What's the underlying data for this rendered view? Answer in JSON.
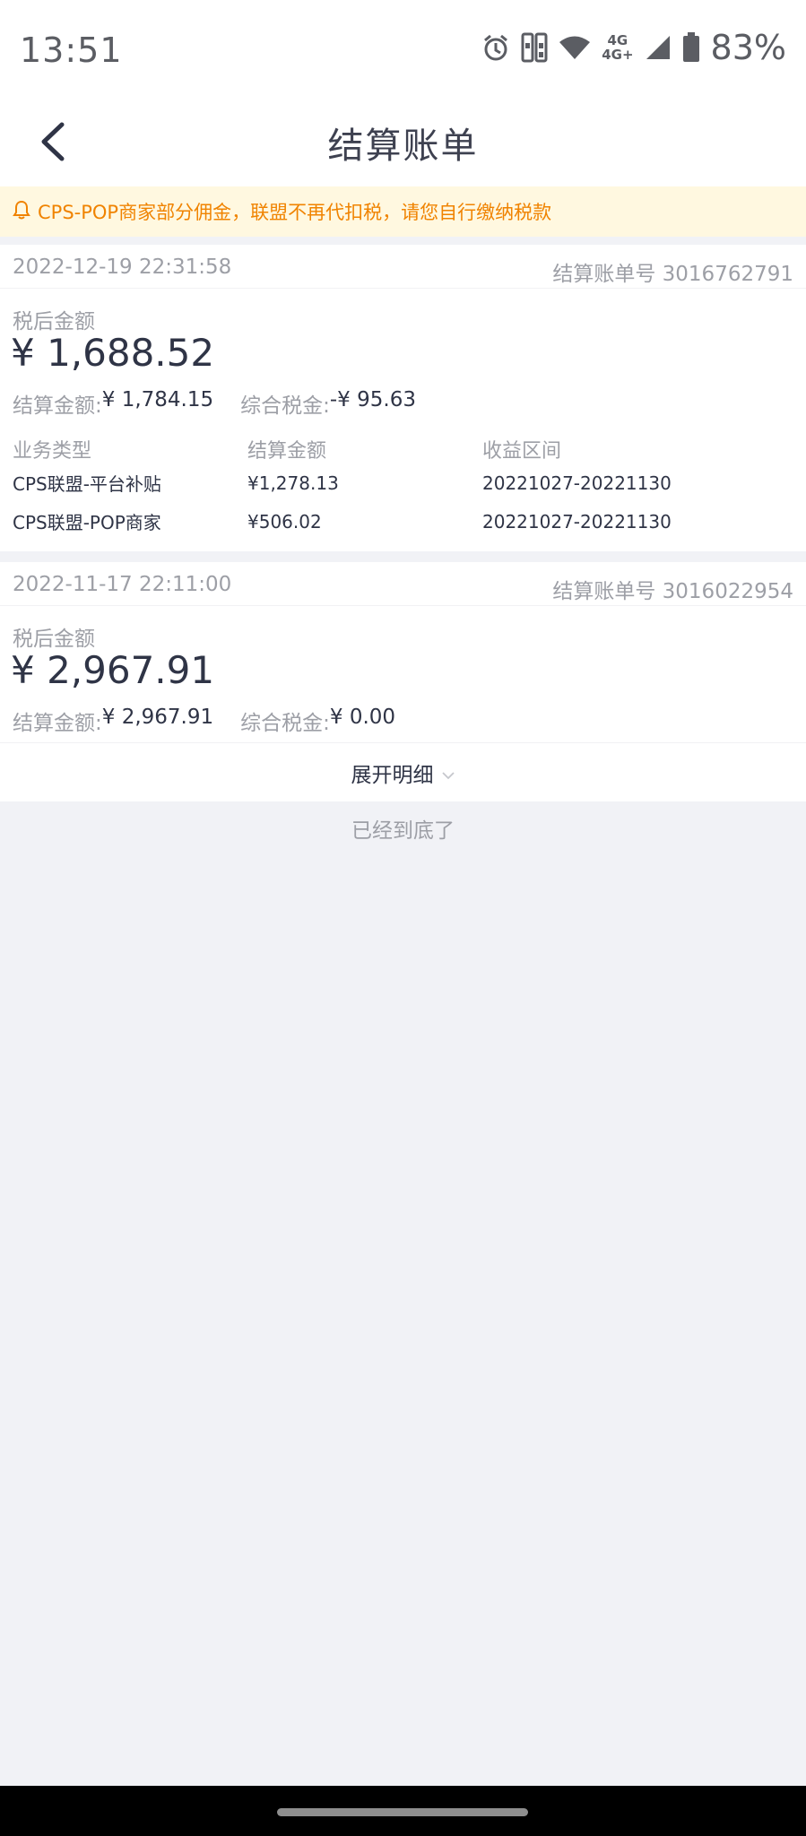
{
  "status_bar": {
    "time": "13:51",
    "network_top": "4G",
    "network_bottom": "4G+",
    "battery": "83%",
    "icons": [
      "alarm-icon",
      "sim-card-icon",
      "wifi-icon",
      "signal-icon",
      "battery-icon"
    ]
  },
  "header": {
    "title": "结算账单",
    "back_icon": "chevron-left-icon"
  },
  "notice": {
    "icon": "bell-icon",
    "text": "CPS-POP商家部分佣金，联盟不再代扣税，请您自行缴纳税款",
    "color": "#f08300"
  },
  "bills": [
    {
      "date": "2022-12-19 22:31:58",
      "bill_no": "结算账单号 3016762791",
      "aftertax_label": "税后金额",
      "aftertax_amount": "¥ 1,688.52",
      "settle_label": "结算金额: ",
      "settle_value": "¥ 1,784.15",
      "tax_label": "综合税金: ",
      "tax_value": "-¥ 95.63",
      "detail_headers": [
        "业务类型",
        "结算金额",
        "收益区间"
      ],
      "detail_rows": [
        [
          "CPS联盟-平台补贴",
          "¥1,278.13",
          "20221027-20221130"
        ],
        [
          "CPS联盟-POP商家",
          "¥506.02",
          "20221027-20221130"
        ]
      ]
    },
    {
      "date": "2022-11-17 22:11:00",
      "bill_no": "结算账单号 3016022954",
      "aftertax_label": "税后金额",
      "aftertax_amount": "¥ 2,967.91",
      "settle_label": "结算金额: ",
      "settle_value": "¥ 2,967.91",
      "tax_label": "综合税金: ",
      "tax_value": "¥ 0.00"
    }
  ],
  "expand": {
    "label": "展开明细",
    "icon": "chevron-down-icon"
  },
  "end_text": "已经到底了"
}
